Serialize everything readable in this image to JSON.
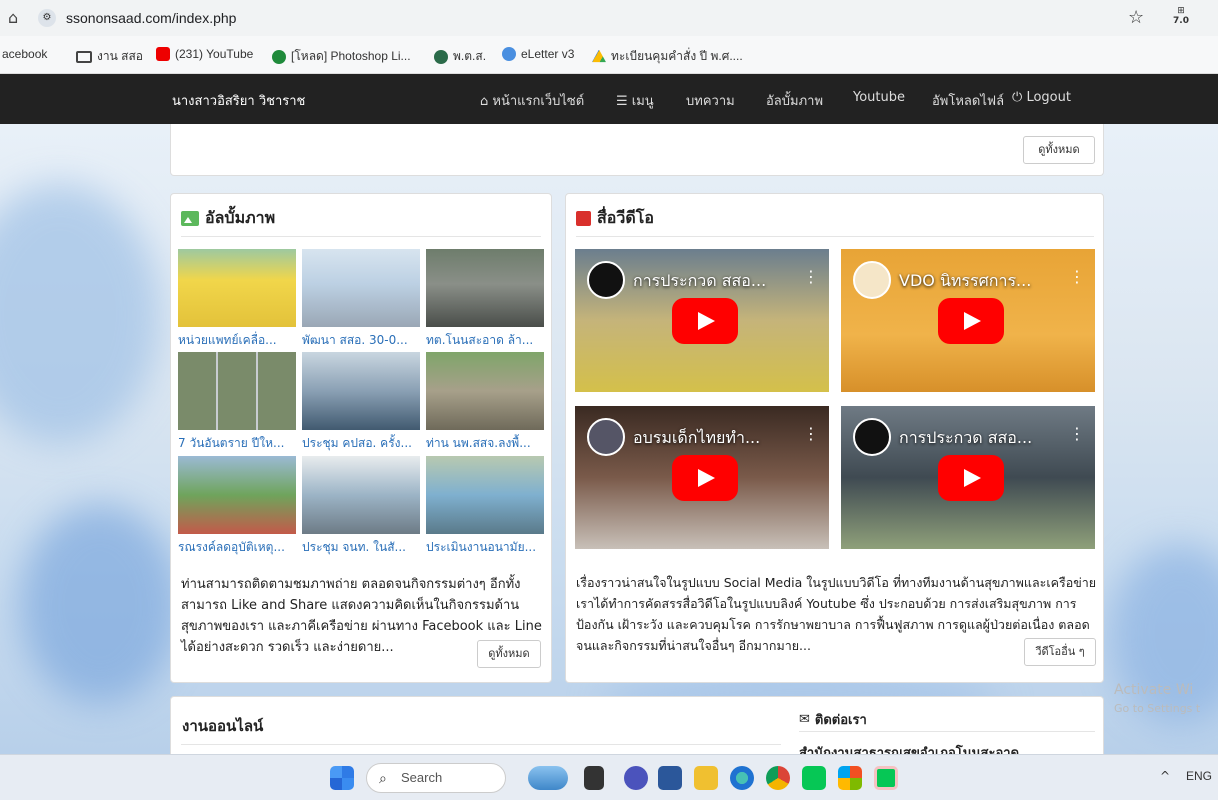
{
  "browser": {
    "url": "ssononsaad.com/index.php",
    "extension_badge": "7.0",
    "bookmarks": [
      {
        "label": "acebook"
      },
      {
        "label": "งาน สสอ"
      },
      {
        "label": "(231) YouTube"
      },
      {
        "label": "[โหลด] Photoshop Li..."
      },
      {
        "label": "พ.ต.ส."
      },
      {
        "label": "eLetter v3"
      },
      {
        "label": "ทะเบียนคุมคำสั่ง ปี พ.ศ...."
      }
    ]
  },
  "nav": {
    "brand": "นางสาวอิสริยา วิชาราช",
    "items": [
      {
        "icon": "home-icon",
        "label": "หน้าแรกเว็บไซต์"
      },
      {
        "icon": "list-icon",
        "label": "เมนู"
      },
      {
        "icon": "",
        "label": "บทความ"
      },
      {
        "icon": "",
        "label": "อัลบั้มภาพ"
      },
      {
        "icon": "",
        "label": "Youtube"
      },
      {
        "icon": "",
        "label": "อัพโหลดไฟล์"
      },
      {
        "icon": "power-icon",
        "label": "Logout"
      }
    ]
  },
  "top_panel": {
    "view_all": "ดูทั้งหมด"
  },
  "album": {
    "title": "อัลบั้มภาพ",
    "items": [
      {
        "caption": "หน่วยแพทย์เคลื่อ..."
      },
      {
        "caption": "พัฒนา สสอ. 30-0..."
      },
      {
        "caption": "ทต.โนนสะอาด ล้า..."
      },
      {
        "caption": "7 วันอันตราย ปีให..."
      },
      {
        "caption": "ประชุม คปสอ. ครั้ง..."
      },
      {
        "caption": "ท่าน นพ.สสจ.ลงพื้..."
      },
      {
        "caption": "รณรงค์ลดอุบัติเหตุ..."
      },
      {
        "caption": "ประชุม จนท. ในสั..."
      },
      {
        "caption": "ประเมินงานอนามัย..."
      }
    ],
    "description": "ท่านสามารถติดตามชมภาพถ่าย ตลอดจนกิจกรรมต่างๆ อีกทั้งสามารถ Like and Share แสดงความคิดเห็นในกิจกรรมด้านสุขภาพของเรา และภาคีเครือข่าย ผ่านทาง Facebook และ Line ได้อย่างสะดวก รวดเร็ว และง่ายดาย...",
    "view_all": "ดูทั้งหมด"
  },
  "video": {
    "title": "สื่อวีดีโอ",
    "items": [
      {
        "title": "การประกวด สสอ..."
      },
      {
        "title": "VDO นิทรรศการ..."
      },
      {
        "title": "อบรมเด็กไทยทำ..."
      },
      {
        "title": "การประกวด สสอ..."
      }
    ],
    "description": "เรื่องราวน่าสนใจในรูปแบบ Social Media ในรูปแบบวิดีโอ ที่ทางทีมงานด้านสุขภาพและเครือข่ายเราได้ทำการคัดสรรสื่อวิดีโอในรูปแบบลิงค์ Youtube ซึ่ง ประกอบด้วย การส่งเสริมสุขภาพ การป้องกัน เฝ้าระวัง และควบคุมโรค การรักษาพยาบาล การฟื้นฟูสภาพ การดูแลผู้ป่วยต่อเนื่อง ตลอดจนและกิจกรรมที่น่าสนใจอื่นๆ อีกมากมาย...",
    "more": "วีดีโออื่น ๆ"
  },
  "bottom": {
    "online_title": "งานออนไลน์",
    "contact_title": "ติดต่อเรา",
    "contact_org": "สำนักงานสาธารณสุขอำเภอโนนสะอาด"
  },
  "watermark": {
    "line1": "Activate Wi",
    "line2": "Go to Settings t"
  },
  "taskbar": {
    "search_placeholder": "Search",
    "language": "ENG"
  }
}
